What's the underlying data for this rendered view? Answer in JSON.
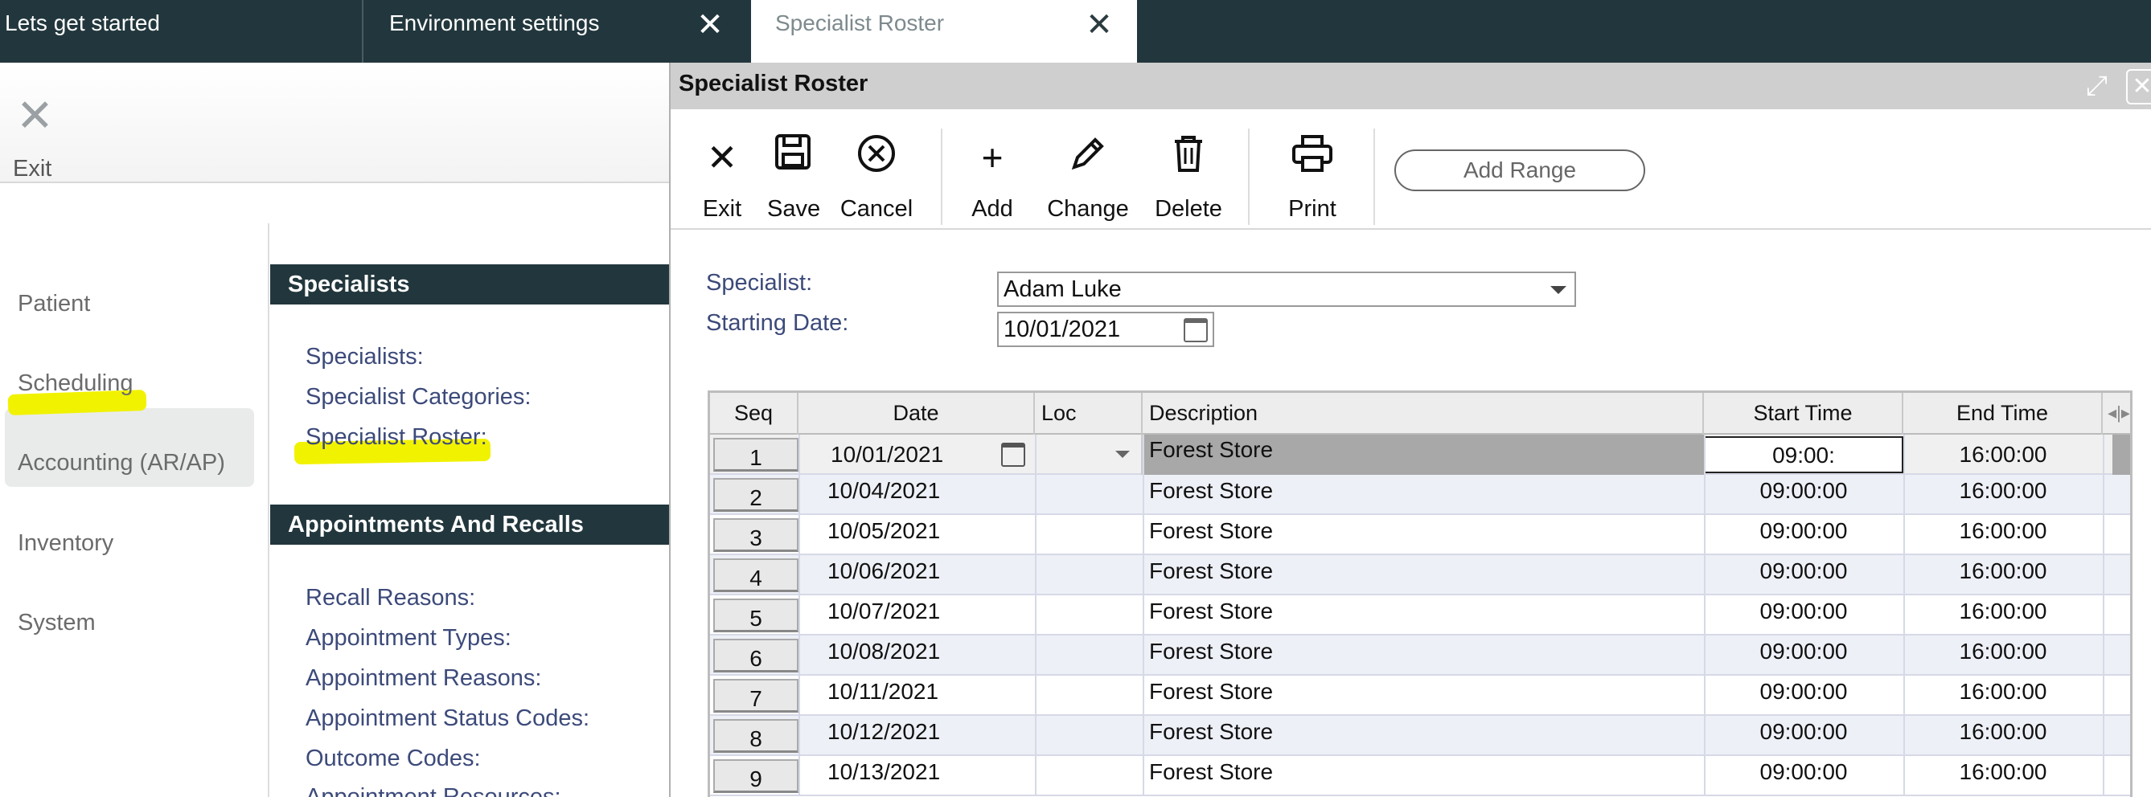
{
  "tabs": [
    {
      "label": "Lets get started"
    },
    {
      "label": "Environment settings",
      "close": "✕"
    },
    {
      "label": "Specialist Roster",
      "close": "✕"
    }
  ],
  "left": {
    "exit_label": "Exit",
    "nav": [
      "Patient",
      "Scheduling",
      "Accounting (AR/AP)",
      "Inventory",
      "System"
    ],
    "sections": [
      {
        "title": "Specialists",
        "links": [
          "Specialists:",
          "Specialist Categories:",
          "Specialist Roster:"
        ]
      },
      {
        "title": "Appointments And Recalls",
        "links": [
          "Recall Reasons:",
          "Appointment Types:",
          "Appointment Reasons:",
          "Appointment Status Codes:",
          "Outcome Codes:",
          "Appointment Resources:"
        ]
      }
    ]
  },
  "dialog": {
    "title": "Specialist Roster",
    "toolbar": {
      "exit": "Exit",
      "save": "Save",
      "cancel": "Cancel",
      "add": "Add",
      "change": "Change",
      "delete": "Delete",
      "print": "Print",
      "add_range": "Add Range"
    },
    "specialist_label": "Specialist:",
    "specialist_value": "Adam Luke",
    "starting_date_label": "Starting Date:",
    "starting_date_value": "10/01/2021",
    "columns": [
      "Seq",
      "Date",
      "Loc",
      "Description",
      "Start Time",
      "End Time"
    ],
    "rows": [
      {
        "seq": "1",
        "date": "10/01/2021",
        "loc": "",
        "desc": "Forest Store",
        "start": "09:00:",
        "end": "16:00:00"
      },
      {
        "seq": "2",
        "date": "10/04/2021",
        "loc": "",
        "desc": "Forest Store",
        "start": "09:00:00",
        "end": "16:00:00"
      },
      {
        "seq": "3",
        "date": "10/05/2021",
        "loc": "",
        "desc": "Forest Store",
        "start": "09:00:00",
        "end": "16:00:00"
      },
      {
        "seq": "4",
        "date": "10/06/2021",
        "loc": "",
        "desc": "Forest Store",
        "start": "09:00:00",
        "end": "16:00:00"
      },
      {
        "seq": "5",
        "date": "10/07/2021",
        "loc": "",
        "desc": "Forest Store",
        "start": "09:00:00",
        "end": "16:00:00"
      },
      {
        "seq": "6",
        "date": "10/08/2021",
        "loc": "",
        "desc": "Forest Store",
        "start": "09:00:00",
        "end": "16:00:00"
      },
      {
        "seq": "7",
        "date": "10/11/2021",
        "loc": "",
        "desc": "Forest Store",
        "start": "09:00:00",
        "end": "16:00:00"
      },
      {
        "seq": "8",
        "date": "10/12/2021",
        "loc": "",
        "desc": "Forest Store",
        "start": "09:00:00",
        "end": "16:00:00"
      },
      {
        "seq": "9",
        "date": "10/13/2021",
        "loc": "",
        "desc": "Forest Store",
        "start": "09:00:00",
        "end": "16:00:00"
      }
    ]
  }
}
